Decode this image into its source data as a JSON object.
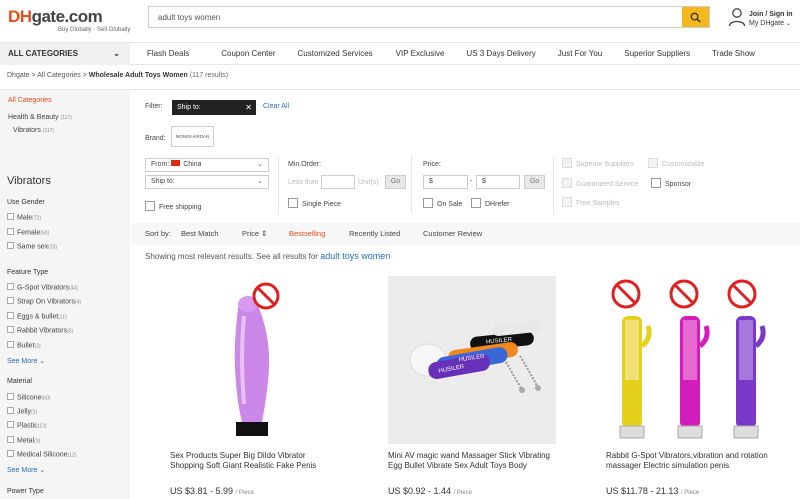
{
  "header": {
    "logo_dh": "DH",
    "logo_gate": "gate.com",
    "tagline": "Buy Globally · Sell Globally",
    "search_value": "adult toys women",
    "user_line1": "Join / Sign in",
    "user_line2": "My DHgate"
  },
  "nav": {
    "all_categories": "ALL CATEGORIES",
    "items": [
      "Flash Deals",
      "Coupon Center",
      "Customized Services",
      "VIP Exclusive",
      "US 3 Days Delivery",
      "Just For You",
      "Superior Suppliers",
      "Trade Show"
    ]
  },
  "breadcrumb": {
    "home": "Dhgate",
    "sep1": " > ",
    "all": "All Categories",
    "sep2": " > ",
    "current": "Wholesale Adult Toys Women",
    "count": " (117 results)"
  },
  "sidebar": {
    "all_categories": "All Categories",
    "health_beauty": "Health & Beauty",
    "health_count": "(117)",
    "vibrators": "Vibrators",
    "vibrators_count": "(117)",
    "section_title": "Vibrators",
    "groups": [
      {
        "title": "Use Gender",
        "items": [
          {
            "label": "Male",
            "count": "(72)"
          },
          {
            "label": "Female",
            "count": "(50)"
          },
          {
            "label": "Same sex",
            "count": "(20)"
          }
        ]
      },
      {
        "title": "Feature Type",
        "items": [
          {
            "label": "G-Spot Vibrators",
            "count": "(44)"
          },
          {
            "label": "Strap On Vibrators",
            "count": "(4)"
          },
          {
            "label": "Eggs & bullet",
            "count": "(11)"
          },
          {
            "label": "Rabbit Vibrators",
            "count": "(6)"
          },
          {
            "label": "Bullet",
            "count": "(3)"
          }
        ],
        "more": "See More ⌄"
      },
      {
        "title": "Material",
        "items": [
          {
            "label": "Silicone",
            "count": "(60)"
          },
          {
            "label": "Jelly",
            "count": "(3)"
          },
          {
            "label": "Plastic",
            "count": "(12)"
          },
          {
            "label": "Metal",
            "count": "(3)"
          },
          {
            "label": "Medical Silicone",
            "count": "(12)"
          }
        ],
        "more": "See More ⌄"
      },
      {
        "title": "Power Type",
        "items": []
      }
    ]
  },
  "filters": {
    "filter_label": "Filter:",
    "ship_tag": "Ship to:",
    "ship_tag_x": "✕",
    "clear_all": "Clear All",
    "brand_label": "Brand:",
    "brand_value": "MONEKAIRDAN",
    "from_label": "From:",
    "from_value": "China",
    "ship_to": "Ship to:",
    "free_shipping": "Free shipping",
    "min_order": "Min.Order:",
    "less_than": "Less than",
    "units": "Unit(s)",
    "go": "Go",
    "single_piece": "Single Piece",
    "price": "Price:",
    "price_from": "$",
    "price_dash": "-",
    "price_to": "$",
    "on_sale": "On Sale",
    "dhrefer": "DHrefer",
    "superior_suppliers": "Superior Suppliers",
    "customizable": "Customizable",
    "guaranteed_service": "Guaranteed Service",
    "sponsor": "Sponsor",
    "free_samples": "Free Samples"
  },
  "sort": {
    "label": "Sort by:",
    "options": [
      "Best Match",
      "Price ⇕",
      "Bestselling",
      "Recently Listed",
      "Customer Review"
    ],
    "active": "Bestselling"
  },
  "results": {
    "prefix": "Showing most relevant results. See all results for ",
    "query": "adult toys women"
  },
  "products": [
    {
      "title": "Sex Products Super Big Dildo Vibrator Shopping Soft Giant Realistic Fake Penis",
      "price": "US $3.81 - 5.99",
      "unit": "/ Piece"
    },
    {
      "title": "Mini AV magic wand Massager Stick Vibrating Egg Bullet Vibrate Sex Adult Toys Body",
      "price": "US $0.92 - 1.44",
      "unit": "/ Piece",
      "image_labels": [
        "HUSILER",
        "HUSILER",
        "HUSILER"
      ]
    },
    {
      "title": "Rabbit G-Spot Vibrators,vibration and rotation massager Electric simulation penis",
      "price": "US $11.78 - 21.13",
      "unit": "/ Piece"
    }
  ],
  "colors": {
    "accent": "#e74c1c",
    "search_button": "#f5b81c",
    "link": "#2a6cb8"
  }
}
